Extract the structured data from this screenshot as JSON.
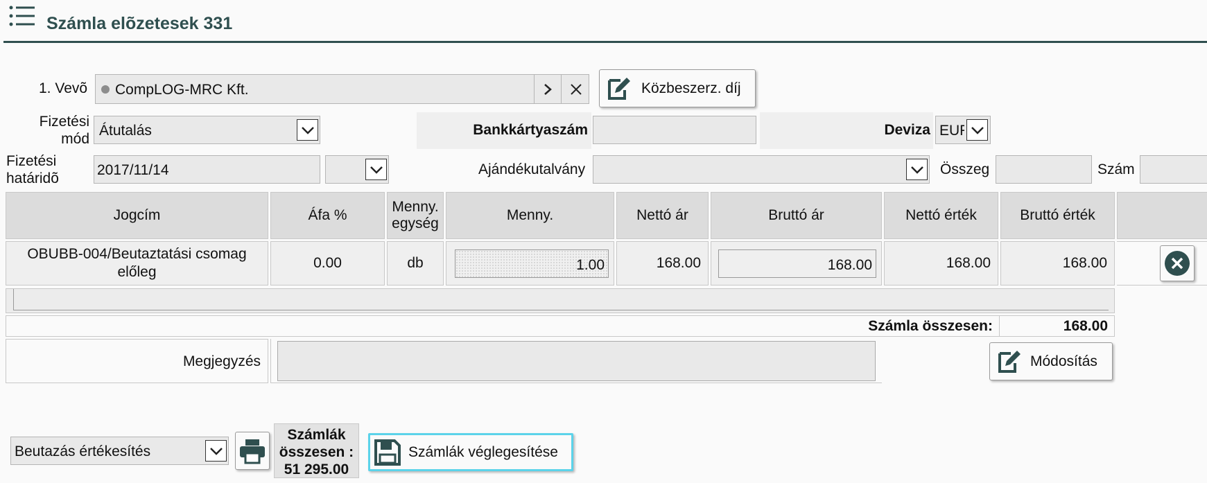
{
  "header": {
    "title": "Számla elõzetesek 331",
    "menu_icon": "list-icon"
  },
  "form": {
    "customer_label": "1. Vevõ",
    "customer_value": "CompLOG-MRC Kft.",
    "public_fee_button": "Közbeszerz. díj",
    "payment_method_label": "Fizetési mód",
    "payment_method_value": "Átutalás",
    "card_number_label": "Bankkártyaszám",
    "card_number_value": "",
    "currency_label": "Deviza",
    "currency_value": "EUR",
    "due_date_label": "Fizetési határidõ",
    "due_date_value": "2017/11/14",
    "voucher_label": "Ajándékutalvány",
    "voucher_value": "",
    "amount_label": "Összeg",
    "amount_value": "",
    "number_label": "Szám",
    "number_value": ""
  },
  "table": {
    "headers": [
      "Jogcím",
      "Áfa %",
      "Menny. egység",
      "Menny.",
      "Nettó ár",
      "Bruttó ár",
      "Nettó érték",
      "Bruttó érték"
    ],
    "rows": [
      {
        "title": "OBUBB-004/Beutaztatási csomag előleg",
        "vat": "0.00",
        "unit": "db",
        "qty": "1.00",
        "net_price": "168.00",
        "gross_price": "168.00",
        "net_value": "168.00",
        "gross_value": "168.00"
      }
    ],
    "total_label": "Számla összesen:",
    "total_value": "168.00"
  },
  "note": {
    "label": "Megjegyzés",
    "value": "",
    "modify_button": "Módosítás"
  },
  "footer": {
    "report_select": "Beutazás értékesítés",
    "totals_label": "Számlák összesen :",
    "totals_value": "51 295.00",
    "finalize_button": "Számlák véglegesítése"
  },
  "colors": {
    "title": "#2f4f4f",
    "accent_border": "#5bd3ea",
    "divider": "#2f4f4f"
  }
}
